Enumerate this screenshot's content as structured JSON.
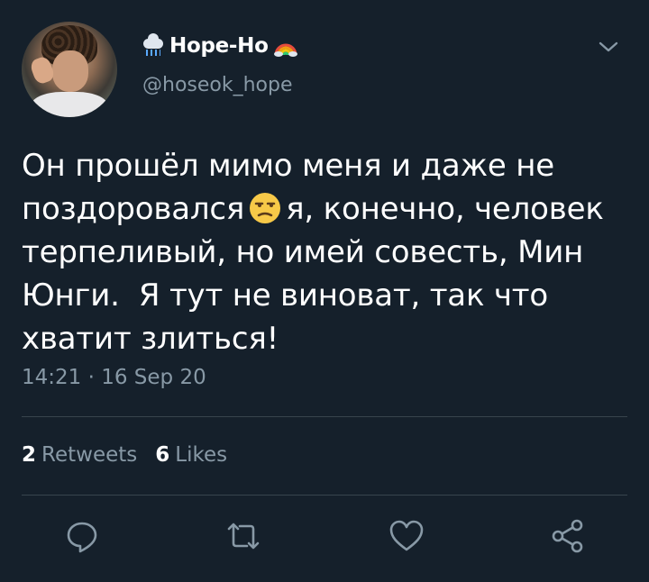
{
  "tweet": {
    "display_name": "Hope-Ho",
    "handle": "@hoseok_hope",
    "lines": [
      "Он прошёл мимо меня и даже не",
      "поздоровался",
      "я, конечно, человек",
      "терпеливый, но имей совесть, Мин",
      "Юнги.  Я тут не виноват, так что",
      "хватит злиться!"
    ],
    "time": "14:21",
    "separator": "·",
    "date": "16 Sep 20"
  },
  "stats": {
    "retweets_count": "2",
    "retweets_label": "Retweets",
    "likes_count": "6",
    "likes_label": "Likes"
  },
  "icons": {
    "name_prefix": "cloud-rain-emoji",
    "name_suffix": "rainbow-emoji",
    "inline": "unamused-face-emoji",
    "menu": "chevron-down-icon",
    "reply": "reply-icon",
    "retweet": "retweet-icon",
    "like": "heart-icon",
    "share": "share-icon"
  },
  "colors": {
    "background": "#15202b",
    "text": "#ffffff",
    "secondary": "#8899a6",
    "divider": "#38444d"
  }
}
